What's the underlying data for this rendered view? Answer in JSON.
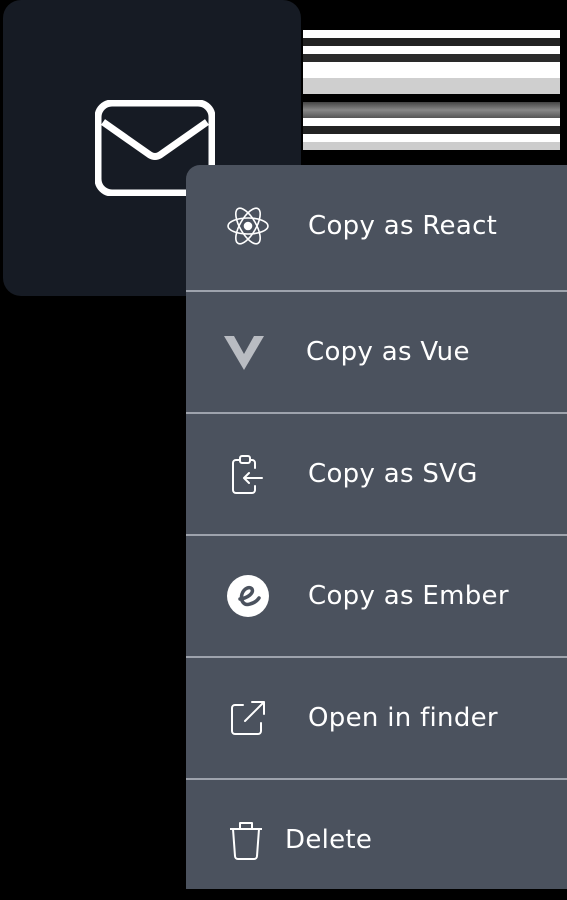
{
  "icon_tile": {
    "icon": "mail-icon"
  },
  "menu": {
    "items": [
      {
        "label": "Copy as React",
        "icon": "react-icon"
      },
      {
        "label": "Copy as Vue",
        "icon": "vue-icon"
      },
      {
        "label": "Copy as SVG",
        "icon": "clipboard-icon"
      },
      {
        "label": "Copy as Ember",
        "icon": "ember-icon"
      },
      {
        "label": "Open in finder",
        "icon": "external-link-icon"
      },
      {
        "label": "Delete",
        "icon": "trash-icon"
      }
    ]
  },
  "colors": {
    "menu_bg": "#4b525e",
    "tile_bg": "#161b24",
    "divider": "#9ea3ad"
  }
}
